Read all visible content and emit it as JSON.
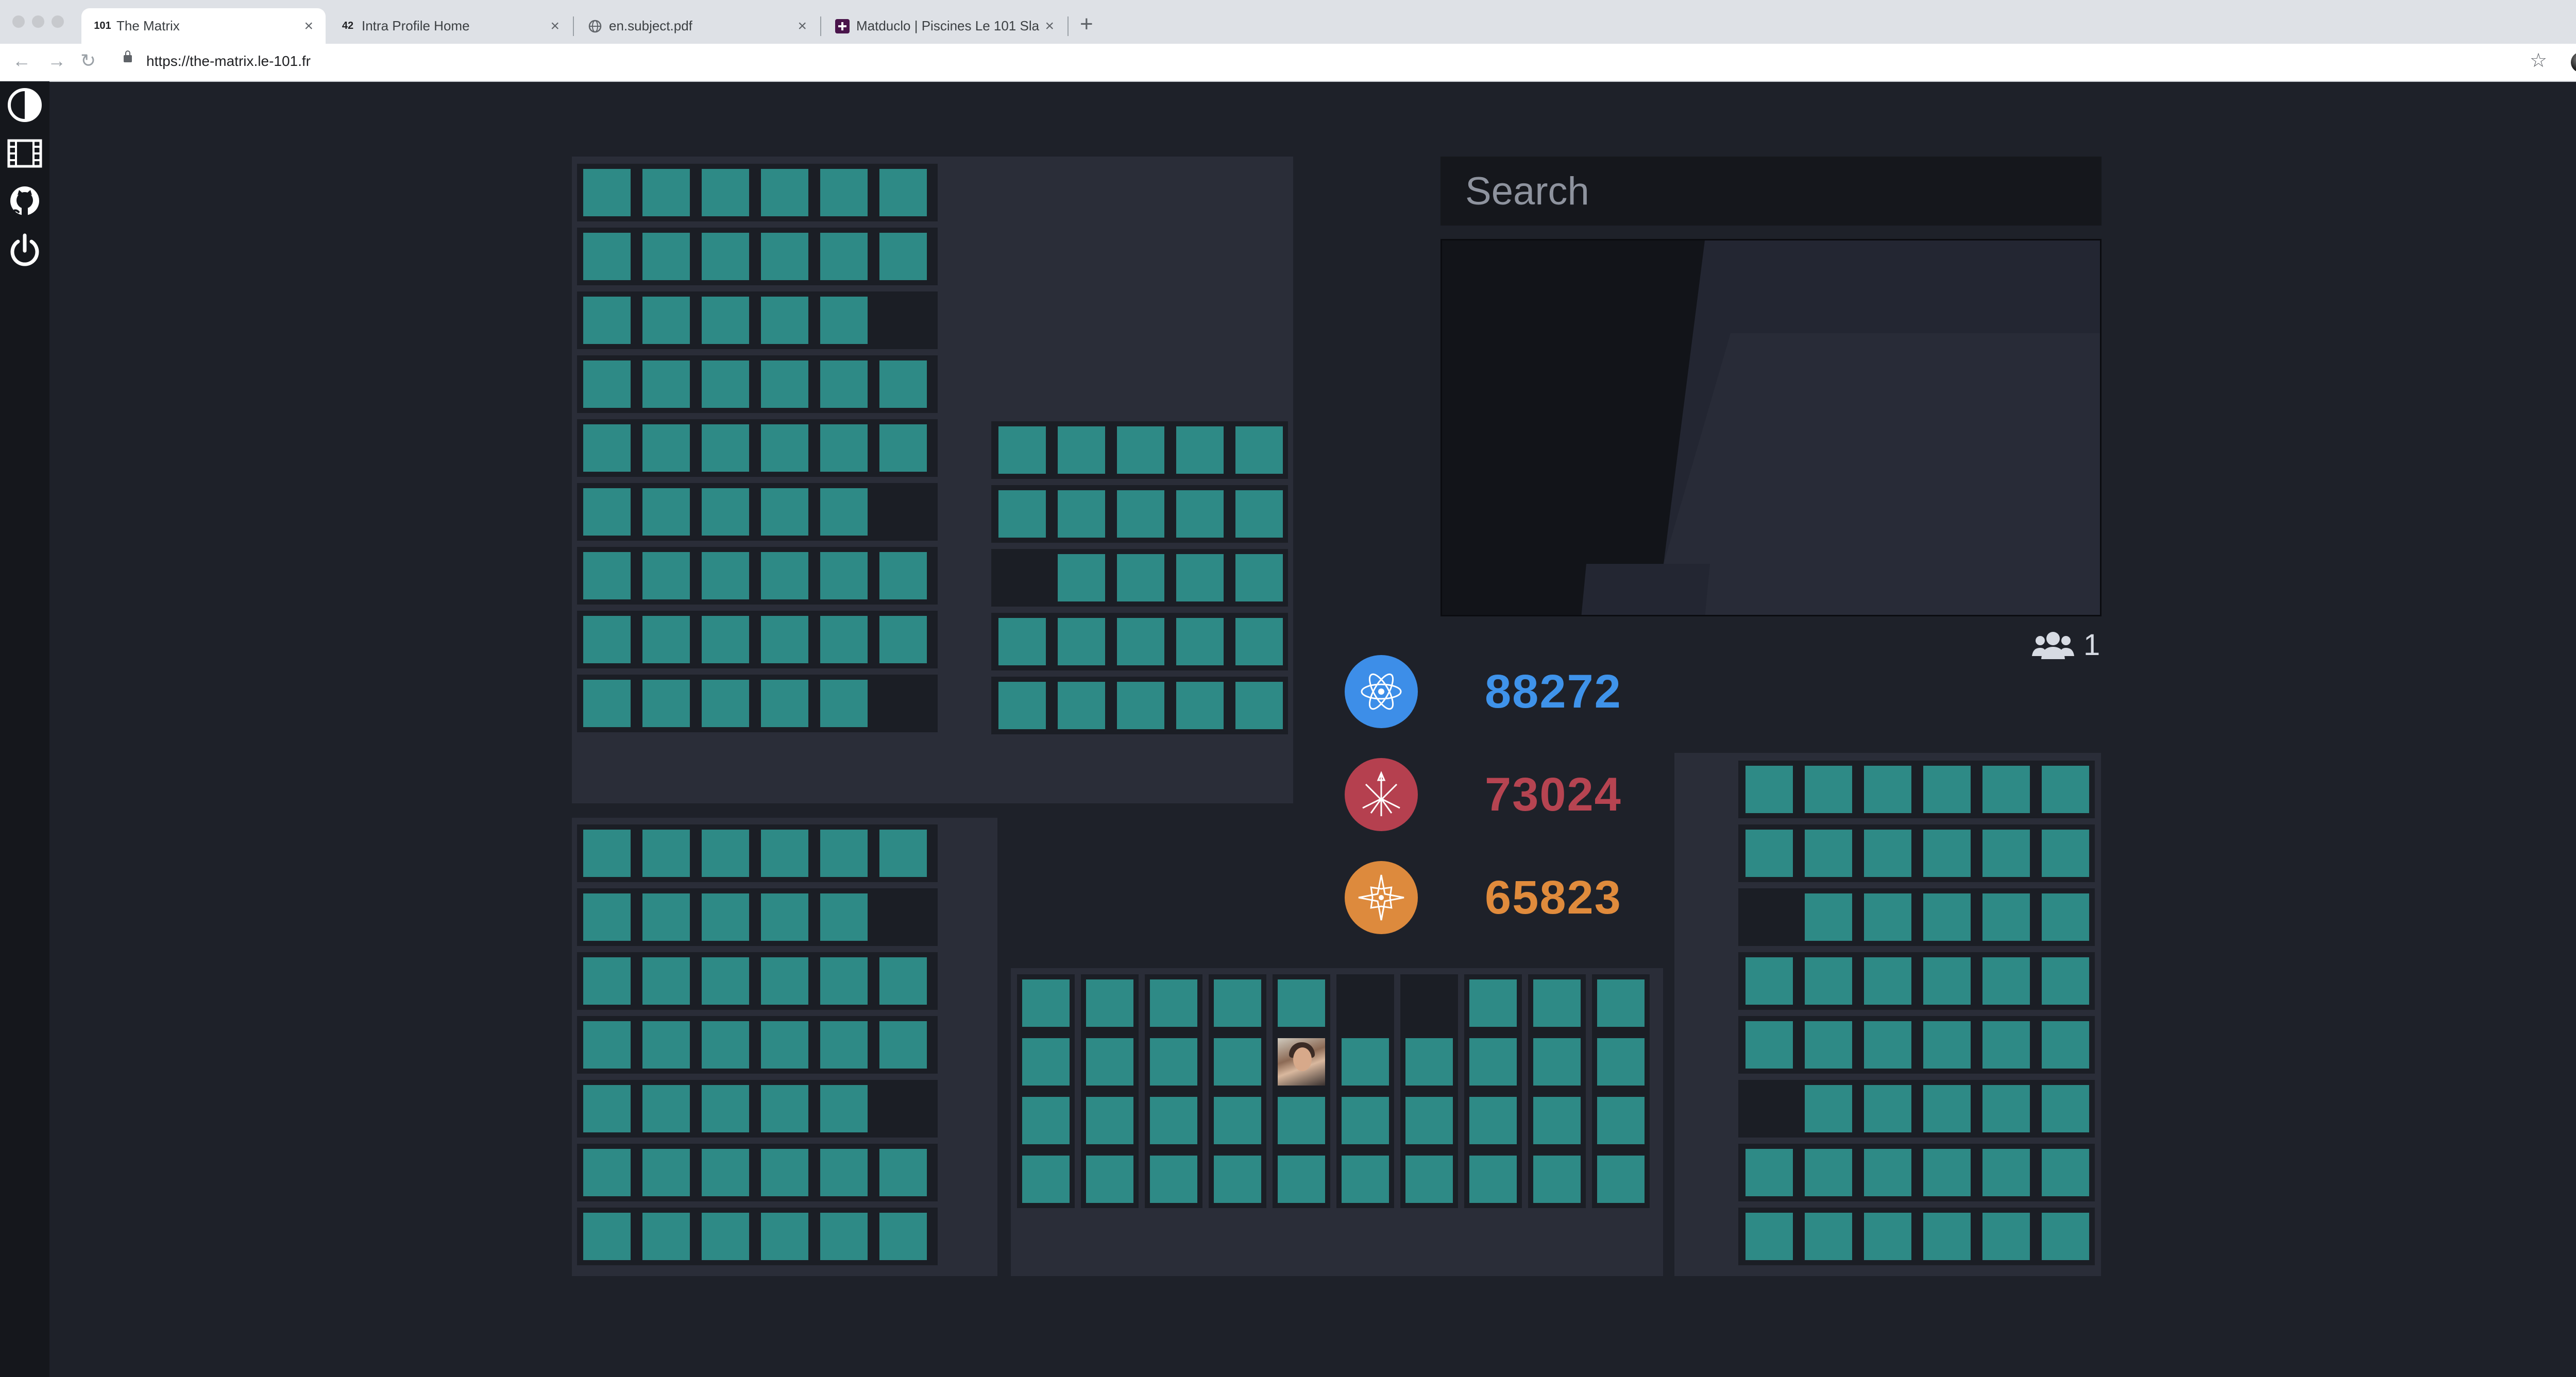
{
  "browser": {
    "tabs": [
      {
        "title": "The Matrix",
        "favicon": "101"
      },
      {
        "title": "Intra Profile Home",
        "favicon": "42"
      },
      {
        "title": "en.subject.pdf",
        "favicon": "globe"
      },
      {
        "title": "Matduclo | Piscines Le 101 Sla",
        "favicon": "slack"
      }
    ],
    "url": "https://the-matrix.le-101.fr"
  },
  "sidebar": [
    {
      "icon": "theme-toggle-icon"
    },
    {
      "icon": "film-icon"
    },
    {
      "icon": "github-icon"
    },
    {
      "icon": "power-icon"
    }
  ],
  "search": {
    "placeholder": "Search"
  },
  "users_online": {
    "icon": "users-icon",
    "count": "1"
  },
  "coalitions": [
    {
      "icon": "atom-icon",
      "score": "88272",
      "color": "#3d8ee8",
      "text_color": "#3f93ea"
    },
    {
      "icon": "trident-icon",
      "score": "73024",
      "color": "#b5404f",
      "text_color": "#b64451"
    },
    {
      "icon": "star-compass-icon",
      "score": "65823",
      "color": "#dd8a3d",
      "text_color": "#e08b3c"
    }
  ],
  "colors": {
    "seat": "#2e8a86",
    "empty_seat": "#1b1e25",
    "panel": "#2a2d38",
    "background": "#1e2129"
  },
  "clusters": [
    {
      "name": "top-left-rows",
      "rows": [
        [
          1,
          1,
          1,
          1,
          1,
          1
        ],
        [
          1,
          1,
          1,
          1,
          1,
          1
        ],
        [
          1,
          1,
          1,
          1,
          1,
          0
        ],
        [
          1,
          1,
          1,
          1,
          1,
          1
        ],
        [
          1,
          1,
          1,
          1,
          1,
          1
        ],
        [
          1,
          1,
          1,
          1,
          1,
          0
        ],
        [
          1,
          1,
          1,
          1,
          1,
          1
        ],
        [
          1,
          1,
          1,
          1,
          1,
          1
        ],
        [
          1,
          1,
          1,
          1,
          1,
          0
        ]
      ]
    },
    {
      "name": "top-right-rows",
      "rows": [
        [
          1,
          1,
          1,
          1,
          1
        ],
        [
          1,
          1,
          1,
          1,
          1
        ],
        [
          0,
          1,
          1,
          1,
          1
        ],
        [
          1,
          1,
          1,
          1,
          1
        ],
        [
          1,
          1,
          1,
          1,
          1
        ]
      ]
    },
    {
      "name": "bottom-left-rows",
      "rows": [
        [
          1,
          1,
          1,
          1,
          1,
          1
        ],
        [
          1,
          1,
          1,
          1,
          1,
          0
        ],
        [
          1,
          1,
          1,
          1,
          1,
          1
        ],
        [
          1,
          1,
          1,
          1,
          1,
          1
        ],
        [
          1,
          1,
          1,
          1,
          1,
          0
        ],
        [
          1,
          1,
          1,
          1,
          1,
          1
        ],
        [
          1,
          1,
          1,
          1,
          1,
          1
        ]
      ]
    },
    {
      "name": "bottom-middle-columns",
      "columns": [
        [
          1,
          1,
          1,
          1
        ],
        [
          1,
          1,
          1,
          1
        ],
        [
          1,
          1,
          1,
          1
        ],
        [
          1,
          1,
          1,
          1
        ],
        [
          1,
          2,
          1,
          1
        ],
        [
          0,
          1,
          1,
          1
        ],
        [
          0,
          1,
          1,
          1
        ],
        [
          1,
          1,
          1,
          1
        ],
        [
          1,
          1,
          1,
          1
        ],
        [
          1,
          1,
          1,
          1
        ]
      ]
    },
    {
      "name": "bottom-right-rows",
      "rows": [
        [
          1,
          1,
          1,
          1,
          1,
          1
        ],
        [
          1,
          1,
          1,
          1,
          1,
          1
        ],
        [
          0,
          1,
          1,
          1,
          1,
          1
        ],
        [
          1,
          1,
          1,
          1,
          1,
          1
        ],
        [
          1,
          1,
          1,
          1,
          1,
          1
        ],
        [
          0,
          1,
          1,
          1,
          1,
          1
        ],
        [
          1,
          1,
          1,
          1,
          1,
          1
        ],
        [
          1,
          1,
          1,
          1,
          1,
          1
        ]
      ]
    }
  ]
}
